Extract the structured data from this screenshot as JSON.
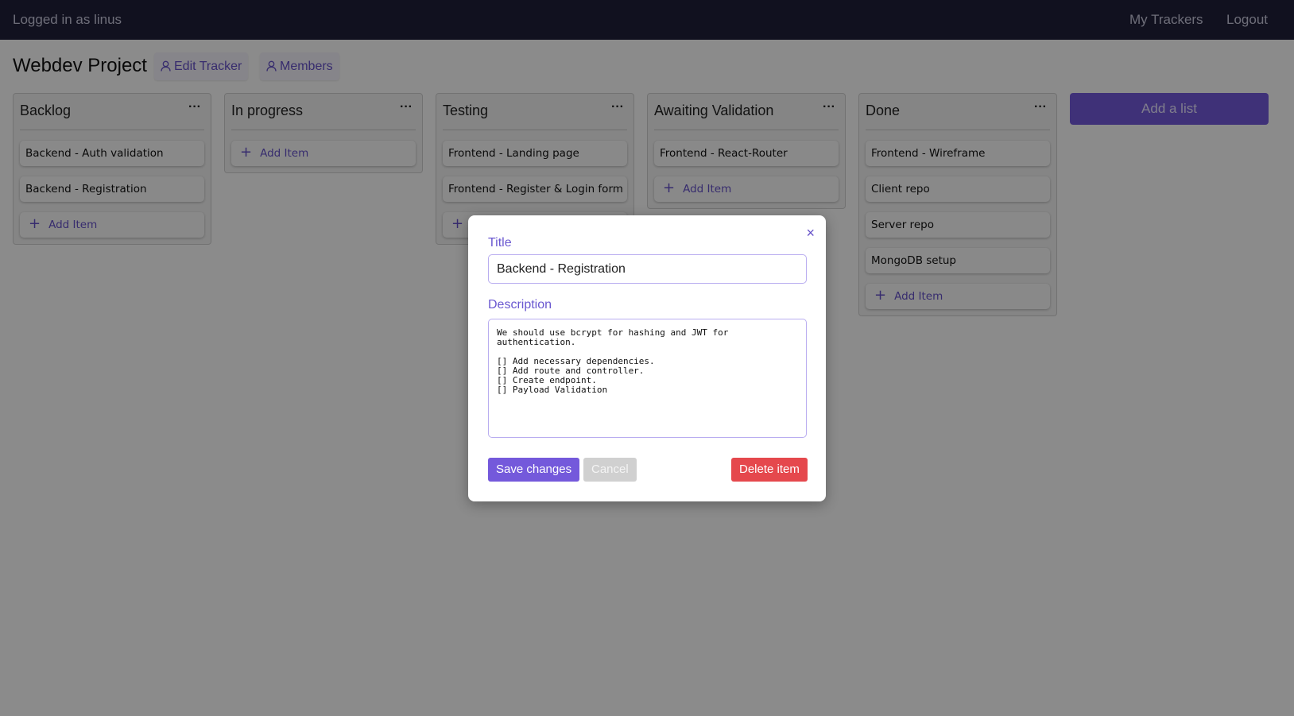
{
  "nav": {
    "user_text": "Logged in as linus",
    "my_trackers": "My Trackers",
    "logout": "Logout"
  },
  "page": {
    "title": "Webdev Project",
    "edit_tracker": "Edit Tracker",
    "members": "Members",
    "add_list": "Add a list",
    "add_item": "Add Item",
    "user_icon": "user-icon",
    "more_icon": "ellipsis-icon"
  },
  "lists": [
    {
      "title": "Backlog",
      "items": [
        "Backend - Auth validation",
        "Backend - Registration"
      ]
    },
    {
      "title": "In progress",
      "items": []
    },
    {
      "title": "Testing",
      "items": [
        "Frontend - Landing page",
        "Frontend - Register & Login form"
      ]
    },
    {
      "title": "Awaiting Validation",
      "items": [
        "Frontend - React-Router"
      ]
    },
    {
      "title": "Done",
      "items": [
        "Frontend - Wireframe",
        "Client repo",
        "Server repo",
        "MongoDB setup"
      ]
    }
  ],
  "modal": {
    "title_label": "Title",
    "title_value": "Backend - Registration",
    "description_label": "Description",
    "description_value": "We should use bcrypt for hashing and JWT for\nauthentication.\n\n[] Add necessary dependencies.\n[] Add route and controller.\n[] Create endpoint.\n[] Payload Validation",
    "save": "Save changes",
    "cancel": "Cancel",
    "delete": "Delete item",
    "close": "×"
  },
  "colors": {
    "accent": "#7459db",
    "danger": "#e5484d",
    "nav": "#1f1f3a"
  }
}
